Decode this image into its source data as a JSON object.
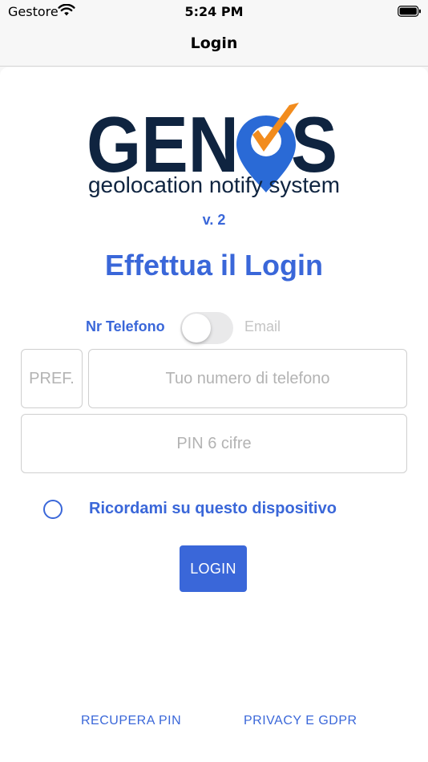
{
  "status_bar": {
    "carrier": "Gestore",
    "time": "5:24 PM",
    "wifi_icon": "wifi-icon",
    "battery_icon": "battery-full-icon"
  },
  "nav": {
    "title": "Login"
  },
  "logo": {
    "brand_text": "GENOS",
    "tagline": "geolocation notify system",
    "colors": {
      "dark": "#0f2440",
      "blue": "#2a6ad6",
      "orange": "#f28c1e"
    }
  },
  "version": "v. 2",
  "heading": "Effettua il Login",
  "toggle": {
    "left_label": "Nr Telefono",
    "right_label": "Email",
    "state": "off"
  },
  "fields": {
    "prefix_placeholder": "PREF.",
    "phone_placeholder": "Tuo numero di telefono",
    "pin_placeholder": "PIN 6 cifre"
  },
  "remember": {
    "label": "Ricordami su questo dispositivo",
    "checked": false
  },
  "login_button": "LOGIN",
  "footer": {
    "recover_pin": "RECUPERA PIN",
    "privacy": "PRIVACY E GDPR"
  },
  "colors": {
    "accent": "#3a67d9",
    "border": "#cfcfcf",
    "placeholder": "#b3b3b3"
  }
}
